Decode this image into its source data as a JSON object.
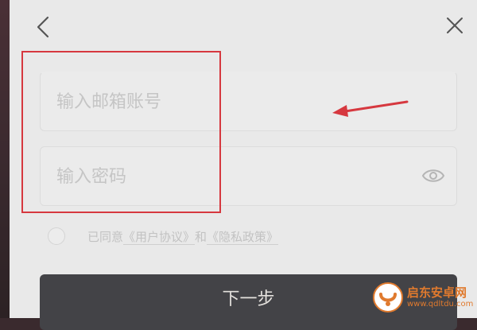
{
  "nav": {
    "back_icon": "chevron-left-icon",
    "close_icon": "close-icon"
  },
  "form": {
    "email_placeholder": "输入邮箱账号",
    "email_value": "",
    "password_placeholder": "输入密码",
    "password_value": "",
    "password_toggle_icon": "eye-icon"
  },
  "agreement": {
    "checked": false,
    "prefix": "已同意",
    "user_agreement": "《用户协议》",
    "conjunction": "和",
    "privacy_policy": "《隐私政策》"
  },
  "actions": {
    "next_label": "下一步"
  },
  "watermark": {
    "name": "启东安卓网",
    "url": "www.qdltdu.com"
  },
  "colors": {
    "sheet_background": "#e9e9e9",
    "button_background": "#434347",
    "annotation_red": "#d6383f",
    "watermark_orange": "#e07a2e"
  }
}
